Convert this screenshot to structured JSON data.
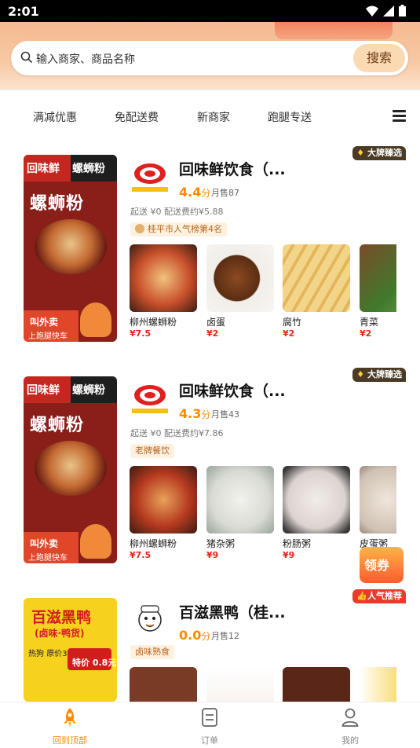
{
  "status_bar": {
    "time": "2:01"
  },
  "search": {
    "placeholder": "输入商家、商品名称",
    "button_label": "搜索"
  },
  "filter_tabs": [
    "满减优惠",
    "免配送费",
    "新商家",
    "跑腿专送"
  ],
  "stores": [
    {
      "name": "回味鲜饮食（...",
      "rating": "4.4",
      "rating_unit": "分",
      "sold": "月售87",
      "delivery": "起送 ¥0  配送费约¥5.88",
      "tag": "桂平市人气榜第4名",
      "badge": "大牌臻选",
      "poster_title_left": "回味鲜",
      "poster_title_right": "螺蛳粉",
      "poster_main": "螺蛳粉",
      "poster_footer": "叫外卖",
      "poster_footer_sub": "上跑腿快车",
      "items": [
        {
          "name": "柳州螺蛳粉",
          "price": "¥7.5"
        },
        {
          "name": "卤蛋",
          "price": "¥2"
        },
        {
          "name": "腐竹",
          "price": "¥2"
        },
        {
          "name": "青菜",
          "price": "¥2"
        }
      ]
    },
    {
      "name": "回味鲜饮食（...",
      "rating": "4.3",
      "rating_unit": "分",
      "sold": "月售43",
      "delivery": "起送 ¥0  配送费约¥7.86",
      "tag": "老牌餐饮",
      "badge": "大牌臻选",
      "poster_title_left": "回味鲜",
      "poster_title_right": "螺蛳粉",
      "poster_main": "螺蛳粉",
      "poster_footer": "叫外卖",
      "poster_footer_sub": "上跑腿快车",
      "items": [
        {
          "name": "柳州螺蛳粉",
          "price": "¥7.5"
        },
        {
          "name": "猪杂粥",
          "price": "¥9"
        },
        {
          "name": "粉肠粥",
          "price": "¥9"
        },
        {
          "name": "皮蛋粥",
          "price": "¥"
        }
      ]
    },
    {
      "name": "百滋黑鸭（桂...",
      "rating": "0.0",
      "rating_unit": "分",
      "sold": "月售12",
      "tag": "卤味熟食",
      "badge": "人气推荐",
      "poster_title": "百滋黑鸭",
      "poster_subtitle": "(卤味·鸭货)",
      "poster_hotdog": "热狗",
      "poster_original": "原价3元",
      "poster_price": "特价 0.8元"
    }
  ],
  "coupon_label": "领券",
  "bottom_nav": [
    {
      "label": "回到顶部",
      "active": true
    },
    {
      "label": "订单",
      "active": false
    },
    {
      "label": "我的",
      "active": false
    }
  ],
  "colors": {
    "accent": "#ff8a00",
    "price": "#e2231a",
    "header": "#f7c9a4"
  }
}
